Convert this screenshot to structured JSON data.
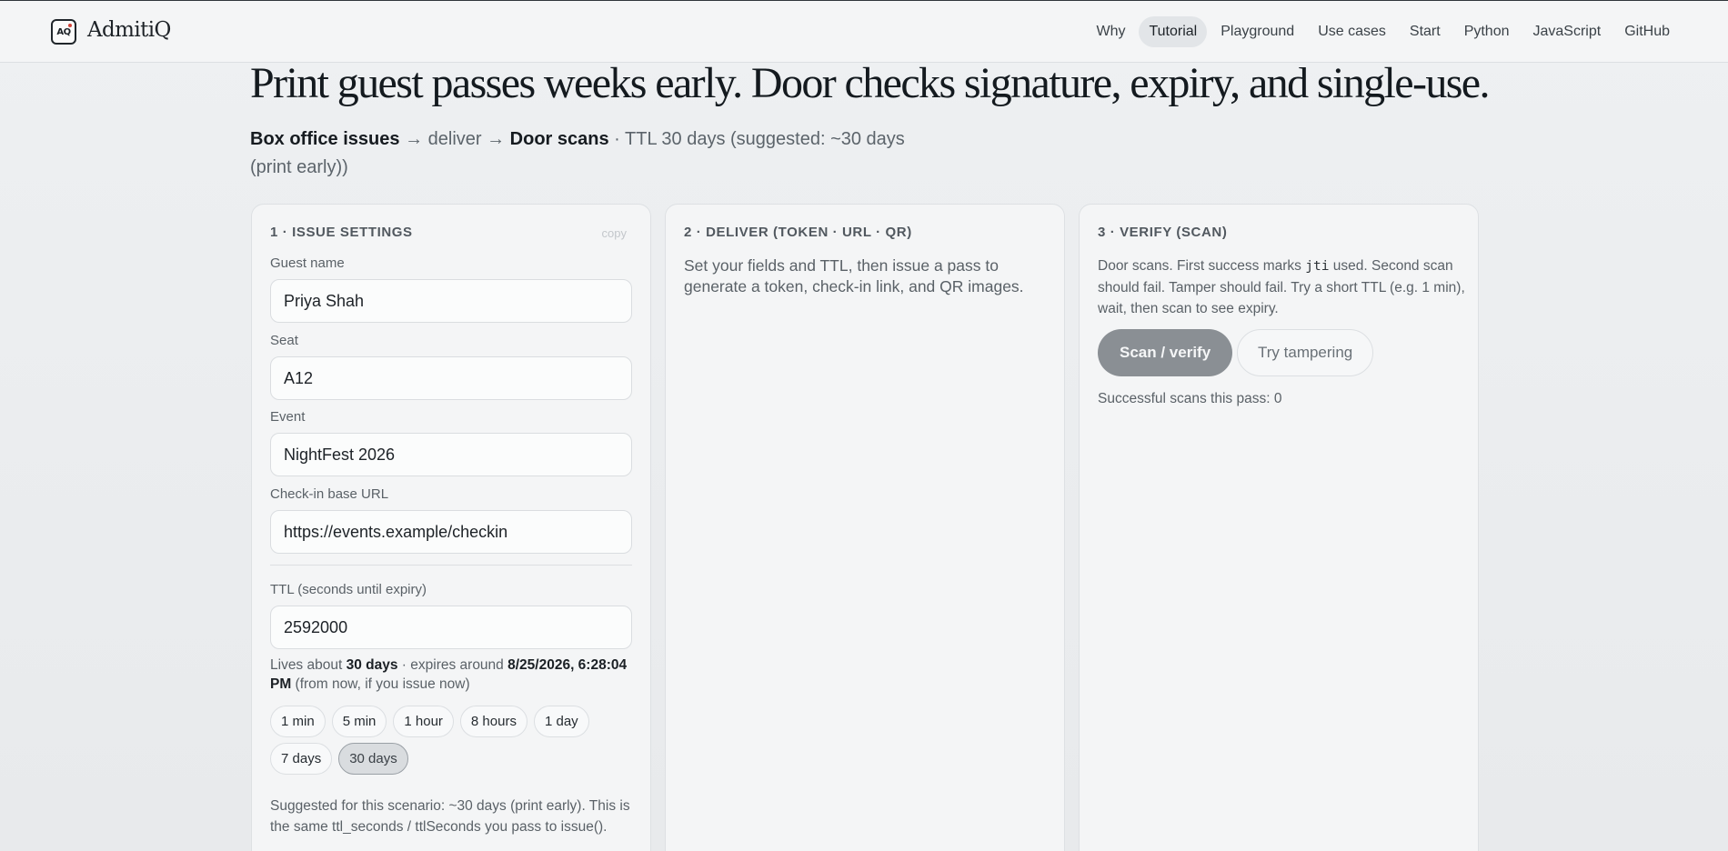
{
  "brand": {
    "logo_text": "AQ",
    "name": "AdmitiQ"
  },
  "nav": {
    "items": [
      "Why",
      "Tutorial",
      "Playground",
      "Use cases",
      "Start",
      "Python",
      "JavaScript",
      "GitHub"
    ],
    "active": "Tutorial"
  },
  "hero": {
    "title": "Print guest passes weeks early. Door checks signature, expiry, and single-use.",
    "sub_issuer": "Box office issues",
    "sub_arrow1": " → deliver → ",
    "sub_verifier": "Door scans",
    "sub_rest": " · TTL 30 days (suggested: ~30 days (print early))"
  },
  "issue": {
    "title": "1 · Issue settings",
    "copy_label": "copy",
    "guest_label": "Guest name",
    "guest_value": "Priya Shah",
    "seat_label": "Seat",
    "seat_value": "A12",
    "event_label": "Event",
    "event_value": "NightFest 2026",
    "url_label": "Check-in base URL",
    "url_value": "https://events.example/checkin",
    "ttl_label": "TTL (seconds until expiry)",
    "ttl_value": "2592000",
    "lives_prefix": "Lives about ",
    "lives_duration": "30 days",
    "lives_mid": " · expires around ",
    "lives_expiry": "8/25/2026, 6:28:04 PM",
    "lives_suffix": " (from now, if you issue now)",
    "presets_row1": [
      "1 min",
      "5 min",
      "1 hour",
      "8 hours",
      "1 day"
    ],
    "presets_row2": [
      "7 days",
      "30 days"
    ],
    "selected_preset": "30 days",
    "suggest": "Suggested for this scenario: ~30 days (print early). This is the same ttl_seconds / ttlSeconds you pass to issue()."
  },
  "deliver": {
    "title": "2 · Deliver (token · URL · QR)",
    "desc": "Set your fields and TTL, then issue a pass to generate a token, check-in link, and QR images."
  },
  "verify": {
    "title": "3 · Verify (scan)",
    "desc_pre": "Door scans. First success marks ",
    "desc_code": "jti",
    "desc_post": " used. Second scan should fail. Tamper should fail. Try a short TTL (e.g. 1 min), wait, then scan to see expiry.",
    "scan_button": "Scan / verify",
    "tamper_button": "Try tampering",
    "scan_count_label": "Successful scans this pass: 0"
  }
}
